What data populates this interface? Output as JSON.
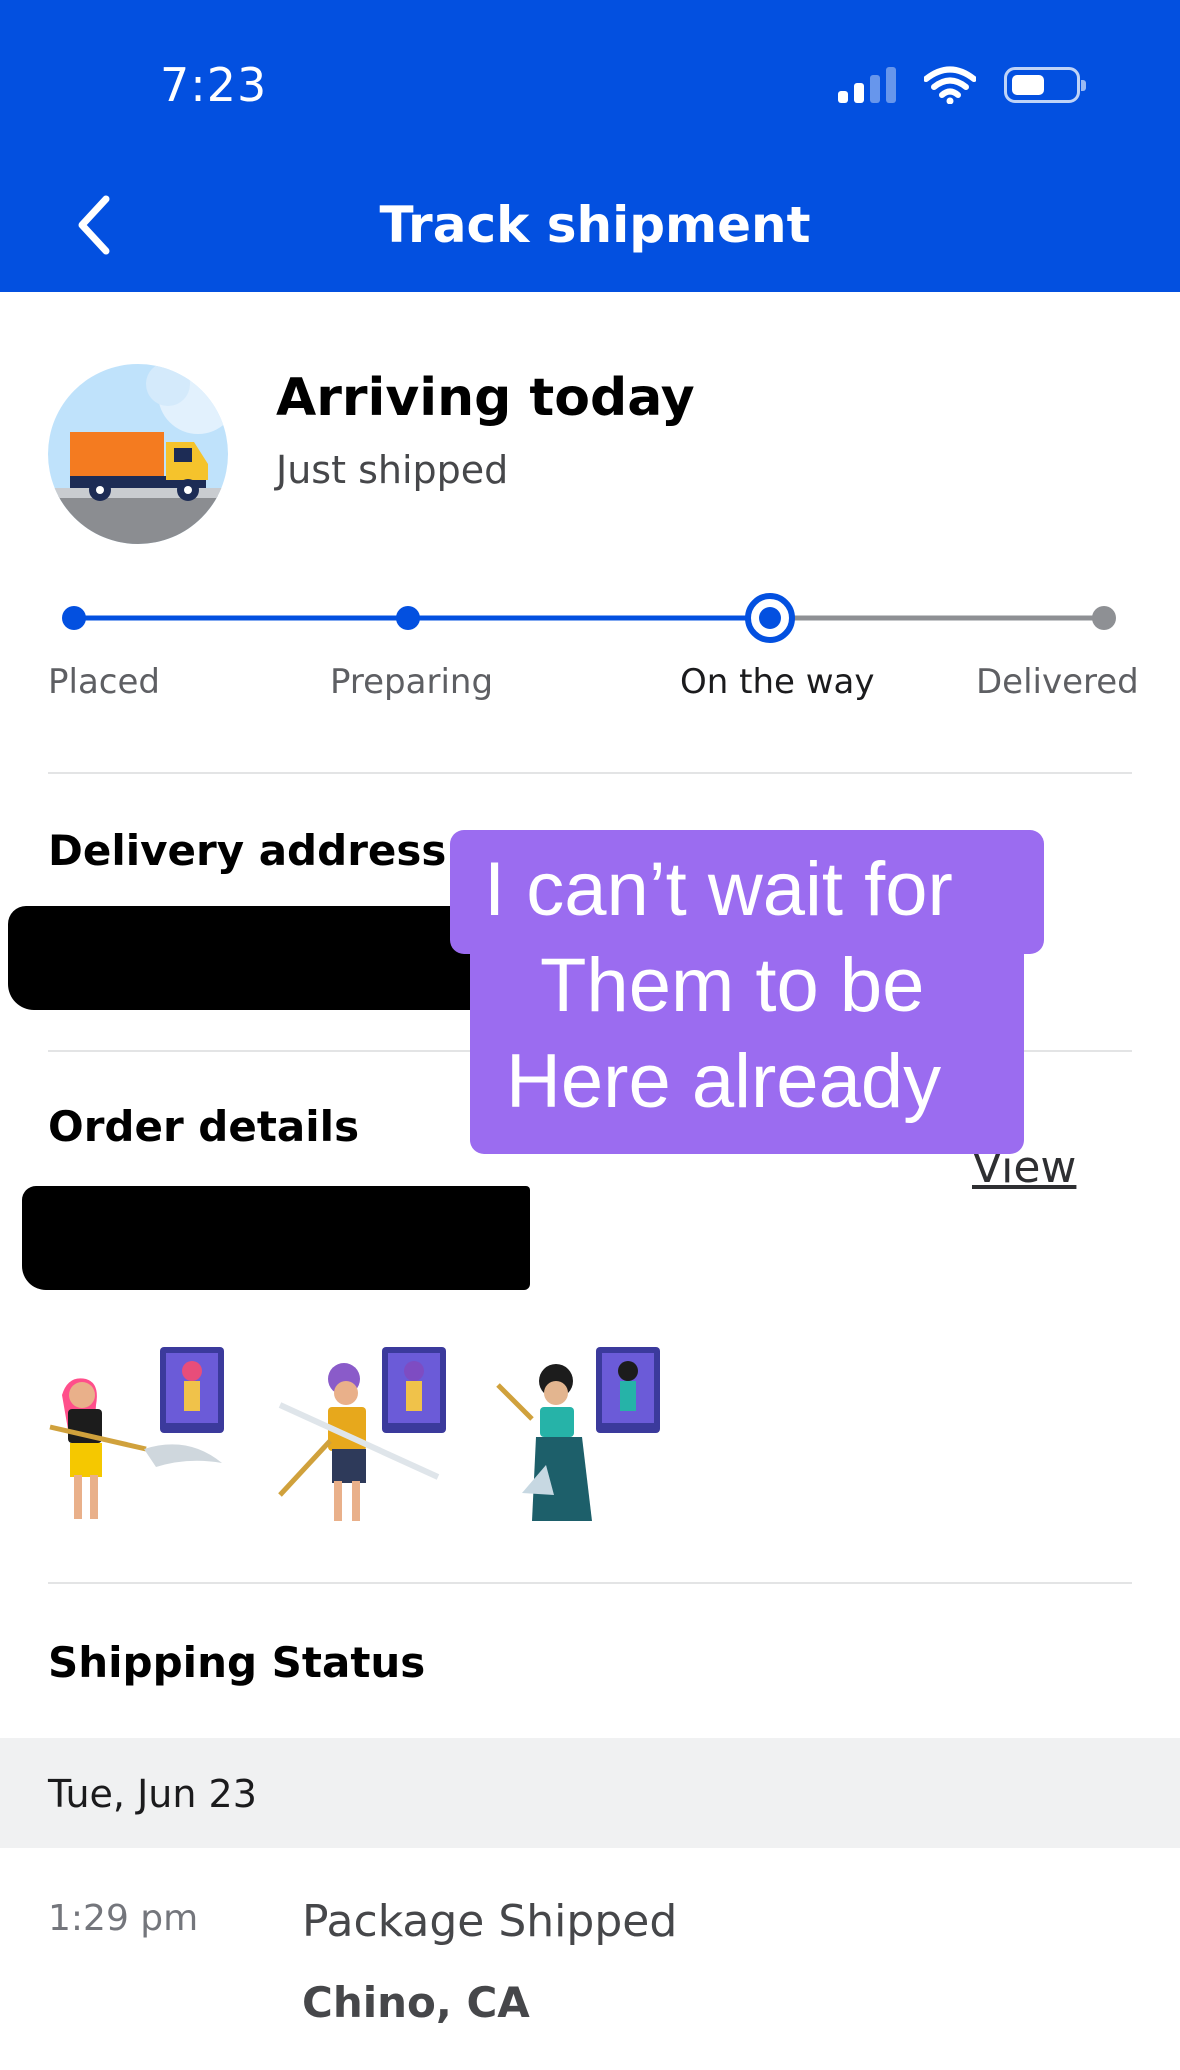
{
  "status_bar": {
    "time": "7:23"
  },
  "nav": {
    "title": "Track shipment",
    "back_icon": "chevron-left-icon"
  },
  "summary": {
    "title": "Arriving today",
    "subtitle": "Just shipped"
  },
  "progress": {
    "steps": [
      "Placed",
      "Preparing",
      "On the way",
      "Delivered"
    ],
    "current_step": "On the way",
    "colors": {
      "done": "#0350e0",
      "pending": "#8e9094"
    }
  },
  "delivery": {
    "title": "Delivery address"
  },
  "order": {
    "title": "Order details",
    "view_label": "View"
  },
  "sticker": {
    "lines": [
      "I can’t wait for",
      "Them to be",
      "Here already"
    ],
    "color": "#9b6cf0"
  },
  "shipping": {
    "title": "Shipping Status",
    "date": "Tue, Jun 23",
    "event": {
      "time": "1:29 pm",
      "title": "Package Shipped",
      "location": "Chino, CA"
    }
  },
  "colors": {
    "brand": "#0350e0"
  }
}
